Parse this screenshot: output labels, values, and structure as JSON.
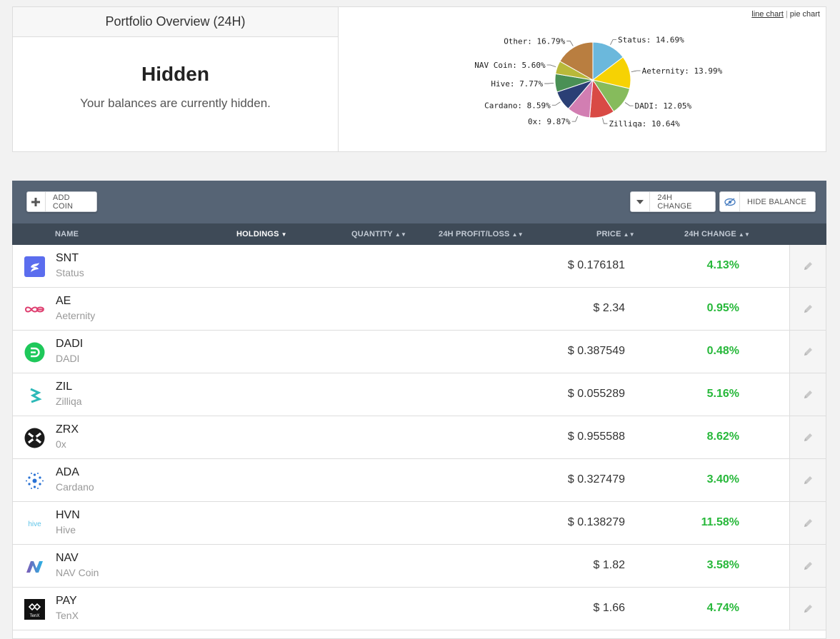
{
  "overview": {
    "title": "Portfolio Overview (24H)",
    "hidden_title": "Hidden",
    "hidden_subtitle": "Your balances are currently hidden.",
    "chart_switch": {
      "line_label": "line chart",
      "separator": "|",
      "pie_label": "pie chart"
    }
  },
  "chart_data": {
    "type": "pie",
    "title": "",
    "slices": [
      {
        "label": "Status",
        "value": 14.69,
        "display": "Status: 14.69%",
        "color": "#6bb8dc"
      },
      {
        "label": "Aeternity",
        "value": 13.99,
        "display": "Aeternity: 13.99%",
        "color": "#f6d203"
      },
      {
        "label": "DADI",
        "value": 12.05,
        "display": "DADI: 12.05%",
        "color": "#86bb5c"
      },
      {
        "label": "Zilliqa",
        "value": 10.64,
        "display": "Zilliqa: 10.64%",
        "color": "#d94a45"
      },
      {
        "label": "0x",
        "value": 9.87,
        "display": "0x: 9.87%",
        "color": "#d27eb2"
      },
      {
        "label": "Cardano",
        "value": 8.59,
        "display": "Cardano: 8.59%",
        "color": "#2b3f75"
      },
      {
        "label": "Hive",
        "value": 7.77,
        "display": "Hive: 7.77%",
        "color": "#4a9055"
      },
      {
        "label": "NAV Coin",
        "value": 5.6,
        "display": "NAV Coin: 5.60%",
        "color": "#b9b93a"
      },
      {
        "label": "Other",
        "value": 16.79,
        "display": "Other: 16.79%",
        "color": "#b97e40"
      }
    ]
  },
  "toolbar": {
    "add_coin_label": "ADD COIN",
    "change_label": "24H CHANGE",
    "hide_balance_label": "HIDE BALANCE"
  },
  "table": {
    "columns": {
      "name": "NAME",
      "holdings": "HOLDINGS",
      "quantity": "QUANTITY",
      "profit": "24H PROFIT/LOSS",
      "price": "PRICE",
      "change": "24H CHANGE"
    },
    "rows": [
      {
        "symbol": "SNT",
        "name": "Status",
        "price": "$ 0.176181",
        "change": "4.13%",
        "icon": "status-logo-icon"
      },
      {
        "symbol": "AE",
        "name": "Aeternity",
        "price": "$ 2.34",
        "change": "0.95%",
        "icon": "aeternity-logo-icon"
      },
      {
        "symbol": "DADI",
        "name": "DADI",
        "price": "$ 0.387549",
        "change": "0.48%",
        "icon": "dadi-logo-icon"
      },
      {
        "symbol": "ZIL",
        "name": "Zilliqa",
        "price": "$ 0.055289",
        "change": "5.16%",
        "icon": "zilliqa-logo-icon"
      },
      {
        "symbol": "ZRX",
        "name": "0x",
        "price": "$ 0.955588",
        "change": "8.62%",
        "icon": "0x-logo-icon"
      },
      {
        "symbol": "ADA",
        "name": "Cardano",
        "price": "$ 0.327479",
        "change": "3.40%",
        "icon": "cardano-logo-icon"
      },
      {
        "symbol": "HVN",
        "name": "Hive",
        "price": "$ 0.138279",
        "change": "11.58%",
        "icon": "hive-logo-icon",
        "logo_text": "hive"
      },
      {
        "symbol": "NAV",
        "name": "NAV Coin",
        "price": "$ 1.82",
        "change": "3.58%",
        "icon": "navcoin-logo-icon"
      },
      {
        "symbol": "PAY",
        "name": "TenX",
        "price": "$ 1.66",
        "change": "4.74%",
        "icon": "tenx-logo-icon",
        "logo_text": "TenX"
      }
    ]
  },
  "colors": {
    "positive": "#27b83a",
    "toolbar_bg": "#566475",
    "header_bg": "#3e4a57"
  }
}
